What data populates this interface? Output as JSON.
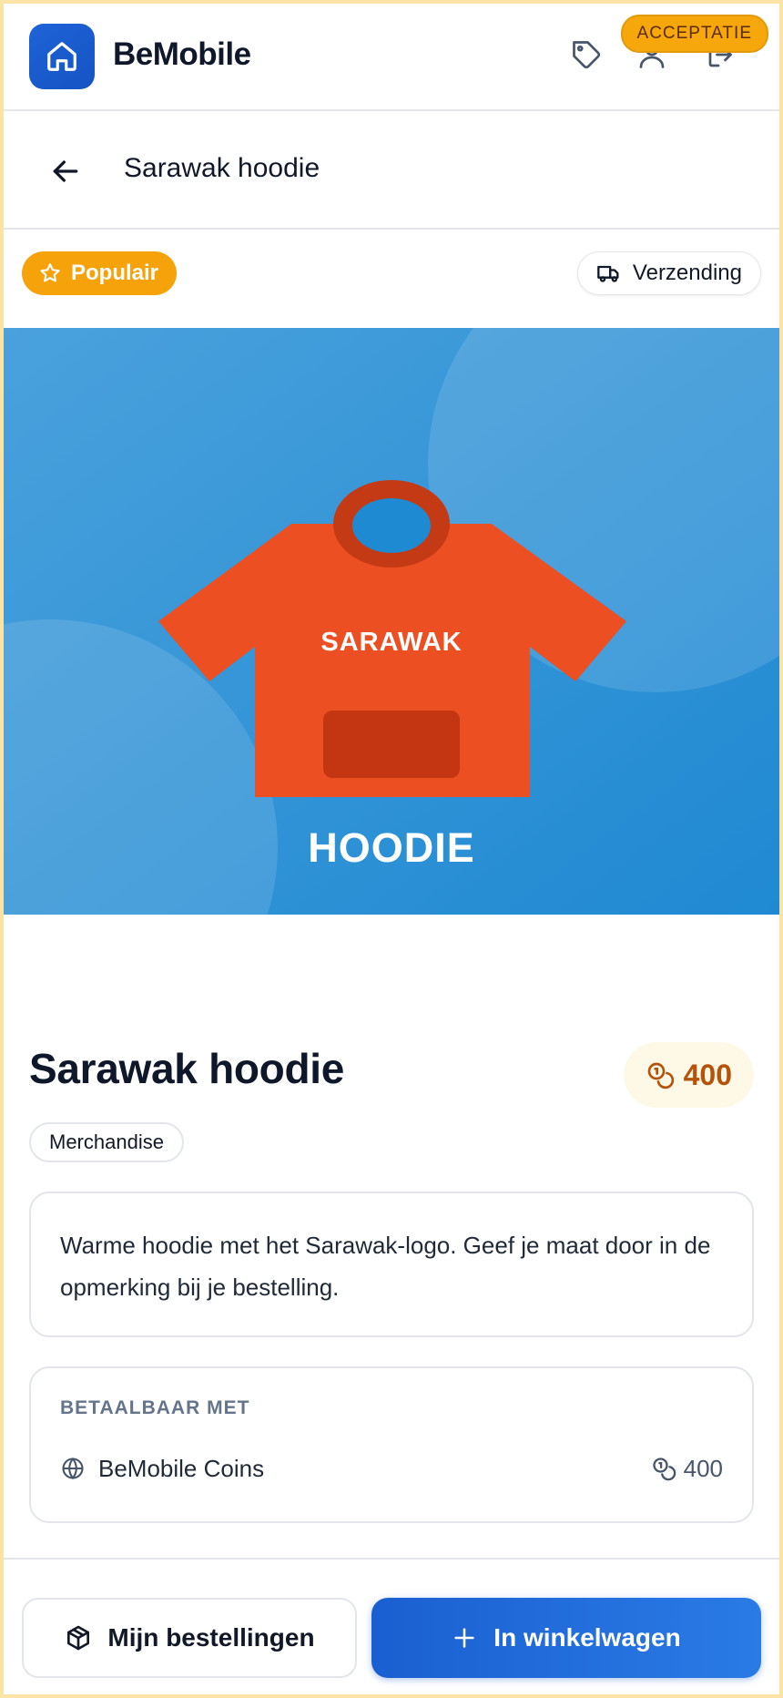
{
  "header": {
    "brand": "BeMobile",
    "env_badge": "ACCEPTATIE",
    "icons": [
      "home-icon",
      "tag-icon",
      "user-icon",
      "logout-icon"
    ]
  },
  "subheader": {
    "title": "Sarawak hoodie",
    "back_icon": "arrow-left-icon"
  },
  "badges": {
    "popular": "Populair",
    "shipping": "Verzending"
  },
  "hero": {
    "shirt_text": "SARAWAK",
    "caption": "HOODIE"
  },
  "product": {
    "title": "Sarawak hoodie",
    "price": "400",
    "category": "Merchandise",
    "description": "Warme hoodie met het Sarawak-logo. Geef je maat door in de opmerking bij je bestelling."
  },
  "payment": {
    "label": "BETAALBAAR MET",
    "method": "BeMobile Coins",
    "amount": "400"
  },
  "actions": {
    "orders": "Mijn bestellingen",
    "add_to_cart": "In winkelwagen"
  },
  "colors": {
    "primary": "#1e63d8",
    "accent": "#f5a20b",
    "hoodie": "#eb4f22",
    "hero_bg": "#3a98d8"
  }
}
